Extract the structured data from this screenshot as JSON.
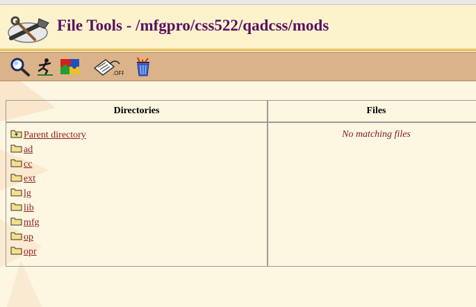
{
  "page": {
    "title": "File Tools - /mfgpro/css522/qadcss/mods"
  },
  "toolbar": {
    "tools": [
      {
        "icon": "magnifier-icon",
        "name": "search-tool"
      },
      {
        "icon": "runner-icon",
        "name": "run-tool"
      },
      {
        "icon": "puzzle-icon",
        "name": "compile-tool"
      },
      {
        "icon": "html-off-icon",
        "name": "html-off-tool"
      },
      {
        "icon": "trash-can-icon",
        "name": "delete-tool"
      }
    ]
  },
  "listing": {
    "directories_header": "Directories",
    "files_header": "Files",
    "parent_label": "Parent directory",
    "directories": [
      "ad",
      "cc",
      "ext",
      "lg",
      "lib",
      "mfg",
      "op",
      "opr"
    ],
    "files_empty_text": "No matching files"
  },
  "colors": {
    "title": "#5a1060",
    "toolbar": "#dbb38a",
    "link": "#8b1c1c",
    "background": "#fdf6e0"
  }
}
